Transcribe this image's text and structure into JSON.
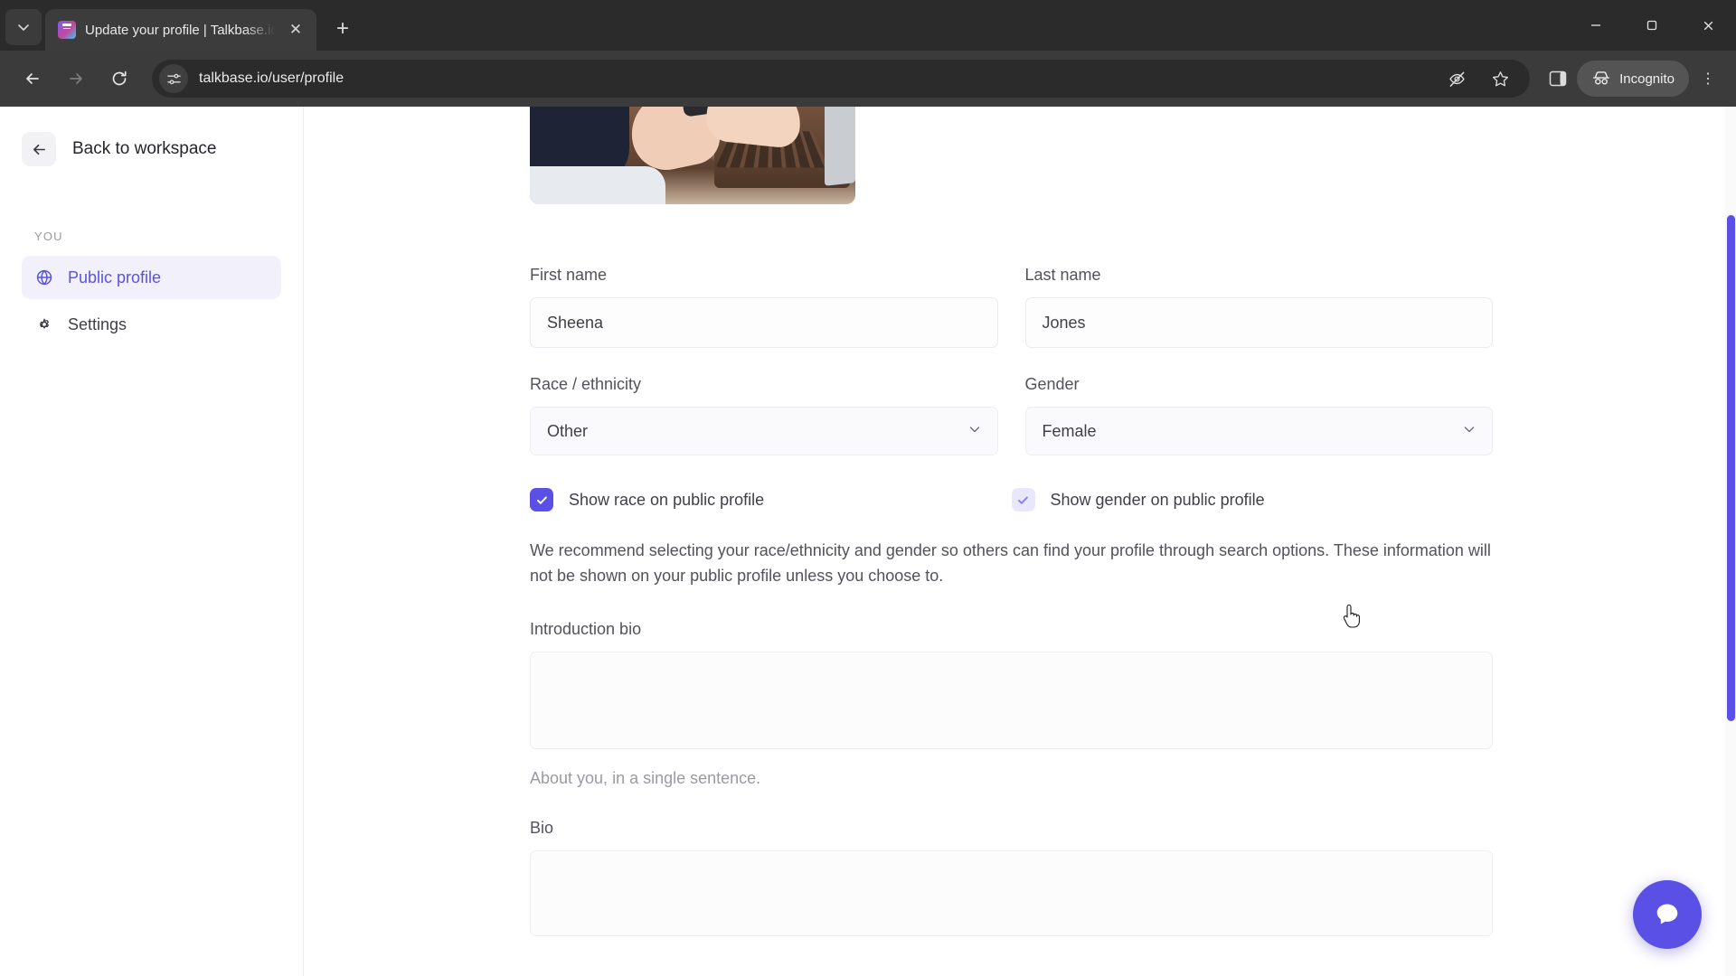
{
  "browser": {
    "tab": {
      "title": "Update your profile | Talkbase.io",
      "favicon_name": "talkbase-favicon",
      "close_label": "✕",
      "tab_search_label": "⌄",
      "new_tab_label": "+"
    },
    "window_controls": {
      "minimize": "─",
      "maximize": "☐",
      "close": "✕"
    },
    "toolbar": {
      "back": "←",
      "forward": "→",
      "reload": "↻",
      "site_info_icon": "site-settings-icon",
      "url": "talkbase.io/user/profile",
      "tracking_protection_icon": "eye-off-icon",
      "bookmark_icon": "star-icon",
      "side_panel_icon": "side-panel-icon",
      "incognito_label": "Incognito",
      "menu": "⋮"
    }
  },
  "sidebar": {
    "back_label": "Back to workspace",
    "back_icon": "arrow-left-icon",
    "section_label": "YOU",
    "items": [
      {
        "label": "Public profile",
        "icon": "globe-icon",
        "active": true
      },
      {
        "label": "Settings",
        "icon": "gear-icon",
        "active": false
      }
    ]
  },
  "main": {
    "banner_alt": "profile-banner-image",
    "fields": {
      "first_name_label": "First name",
      "first_name_value": "Sheena",
      "last_name_label": "Last name",
      "last_name_value": "Jones",
      "race_label": "Race / ethnicity",
      "race_value": "Other",
      "gender_label": "Gender",
      "gender_value": "Female"
    },
    "checkboxes": [
      {
        "label": "Show race on public profile",
        "checked": true,
        "state": "checked"
      },
      {
        "label": "Show gender on public profile",
        "checked": true,
        "state": "hover"
      }
    ],
    "help_text": "We recommend selecting your race/ethnicity and gender so others can find your profile through search options. These information will not be shown on your public profile unless you choose to.",
    "intro_bio_label": "Introduction bio",
    "intro_bio_value": "",
    "intro_bio_hint": "About you, in a single sentence.",
    "bio_label": "Bio",
    "bio_value": ""
  },
  "widgets": {
    "chat_label": "chat-bubble-icon"
  },
  "colors": {
    "accent": "#5b50e6",
    "sidebar_active_bg": "#f2f1fb",
    "chrome_bg": "#3b3b3b",
    "tabstrip_bg": "#2b2b2b"
  }
}
